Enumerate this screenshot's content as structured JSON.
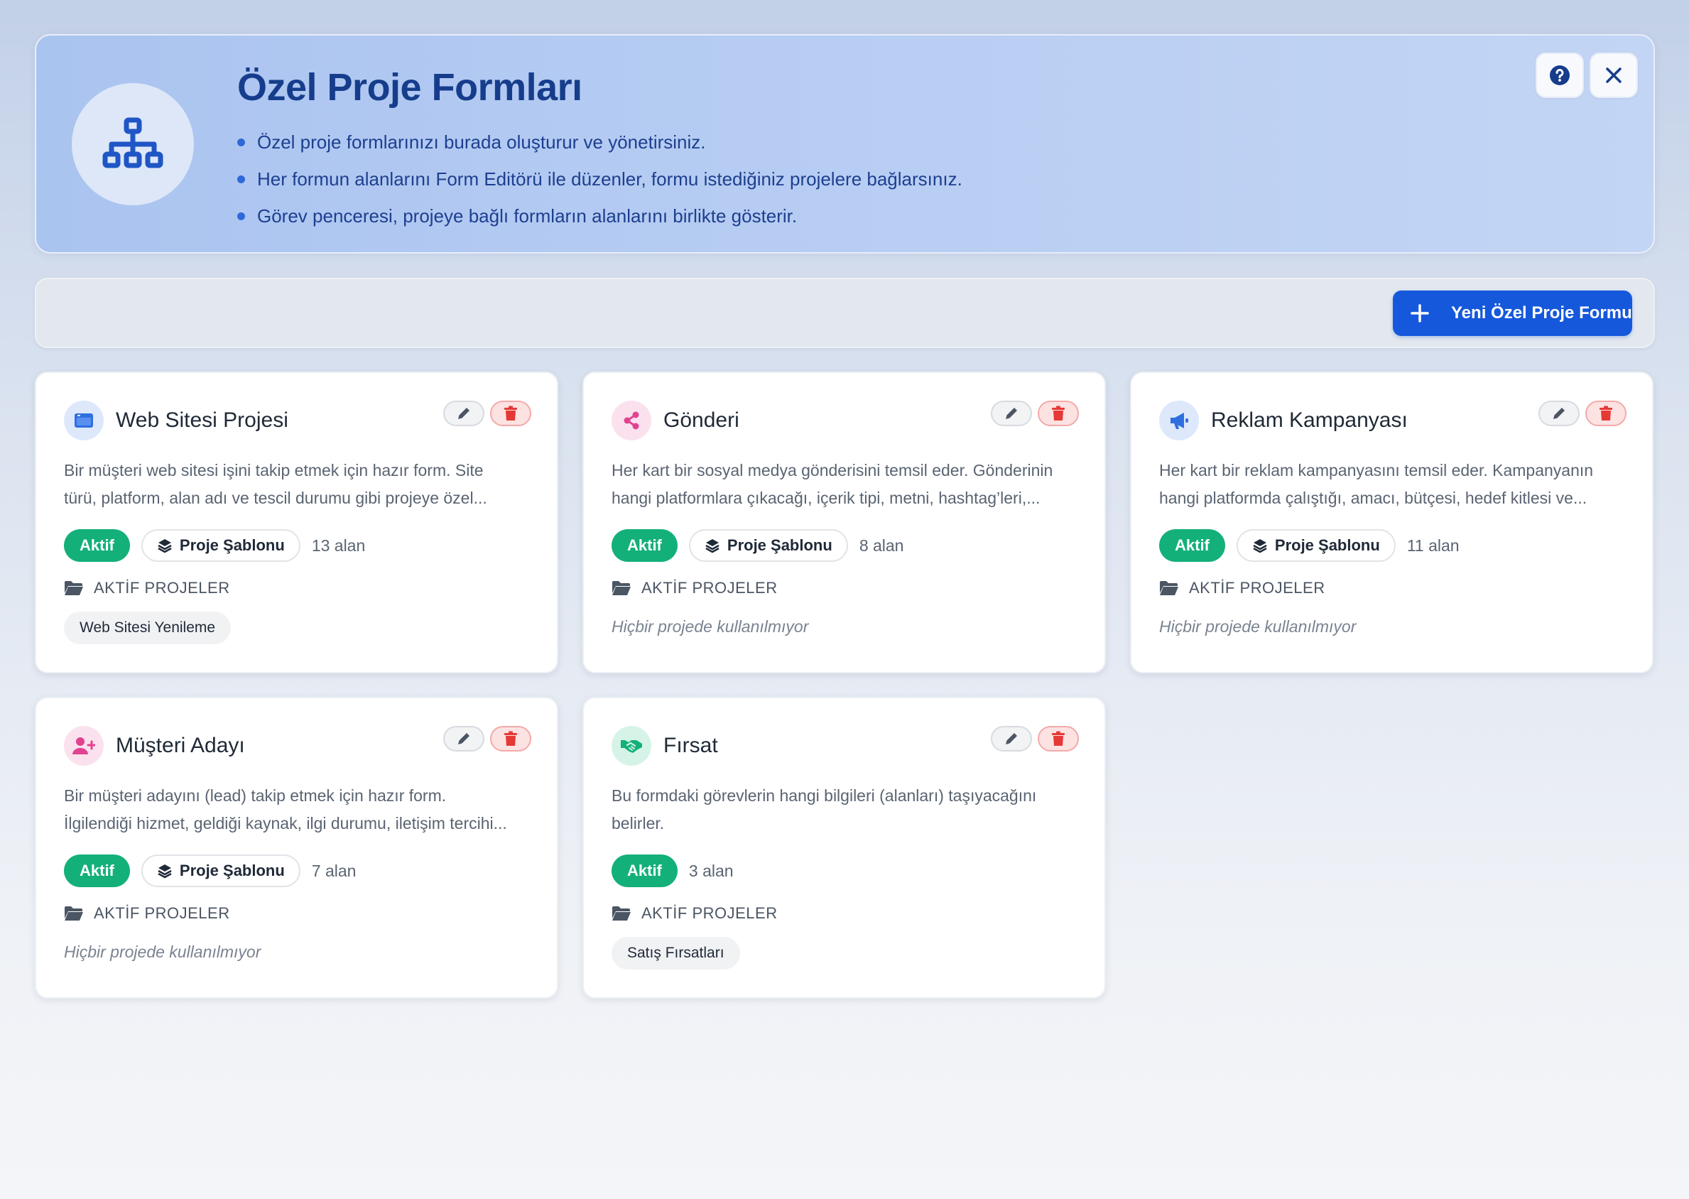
{
  "header": {
    "title": "Özel Proje Formları",
    "bullets": [
      "Özel proje formlarınızı burada oluşturur ve yönetirsiniz.",
      "Her formun alanlarını Form Editörü ile düzenler, formu istediğiniz projelere bağlarsınız.",
      "Görev penceresi, projeye bağlı formların alanlarını birlikte gösterir."
    ],
    "icons": {
      "logo": "sitemap-icon",
      "help": "question-circle-icon",
      "close": "close-icon"
    }
  },
  "toolbar": {
    "new_button_label": "Yeni Özel Proje Formu"
  },
  "labels": {
    "active_projects": "AKTİF PROJELER"
  },
  "colors": {
    "primary": "#1558db",
    "active_badge": "#13b07a",
    "delete": "#e53935",
    "banner_title": "#163d8c"
  },
  "cards": [
    {
      "title": "Web Sitesi Projesi",
      "icon": "browser-window-icon",
      "desc_line1": "Bir müşteri web sitesi işini takip etmek için hazır form. Site",
      "desc_line2": "türü, platform, alan adı ve tescil durumu gibi projeye özel...",
      "status": "Aktif",
      "template": "Proje Şablonu",
      "field_count": "13 alan",
      "project": "Web Sitesi Yenileme"
    },
    {
      "title": "Gönderi",
      "icon": "share-icon",
      "desc_line1": "Her kart bir sosyal medya gönderisini temsil eder. Gönderinin",
      "desc_line2": "hangi platformlara çıkacağı, içerik tipi, metni, hashtag’leri,...",
      "status": "Aktif",
      "template": "Proje Şablonu",
      "field_count": "8 alan",
      "empty_text": "Hiçbir projede kullanılmıyor"
    },
    {
      "title": "Reklam Kampanyası",
      "icon": "megaphone-icon",
      "desc_line1": "Her kart bir reklam kampanyasını temsil eder. Kampanyanın",
      "desc_line2": "hangi platformda çalıştığı, amacı, bütçesi, hedef kitlesi ve...",
      "status": "Aktif",
      "template": "Proje Şablonu",
      "field_count": "11 alan",
      "empty_text": "Hiçbir projede kullanılmıyor"
    },
    {
      "title": "Müşteri Adayı",
      "icon": "user-plus-icon",
      "desc_line1": "Bir müşteri adayını (lead) takip etmek için hazır form.",
      "desc_line2": "İlgilendiği hizmet, geldiği kaynak, ilgi durumu, iletişim tercihi...",
      "status": "Aktif",
      "template": "Proje Şablonu",
      "field_count": "7 alan",
      "empty_text": "Hiçbir projede kullanılmıyor"
    },
    {
      "title": "Fırsat",
      "icon": "handshake-icon",
      "desc_line1": "Bu formdaki görevlerin hangi bilgileri (alanları) taşıyacağını",
      "desc_line2": "belirler.",
      "status": "Aktif",
      "field_count": "3 alan",
      "project": "Satış Fırsatları"
    }
  ]
}
